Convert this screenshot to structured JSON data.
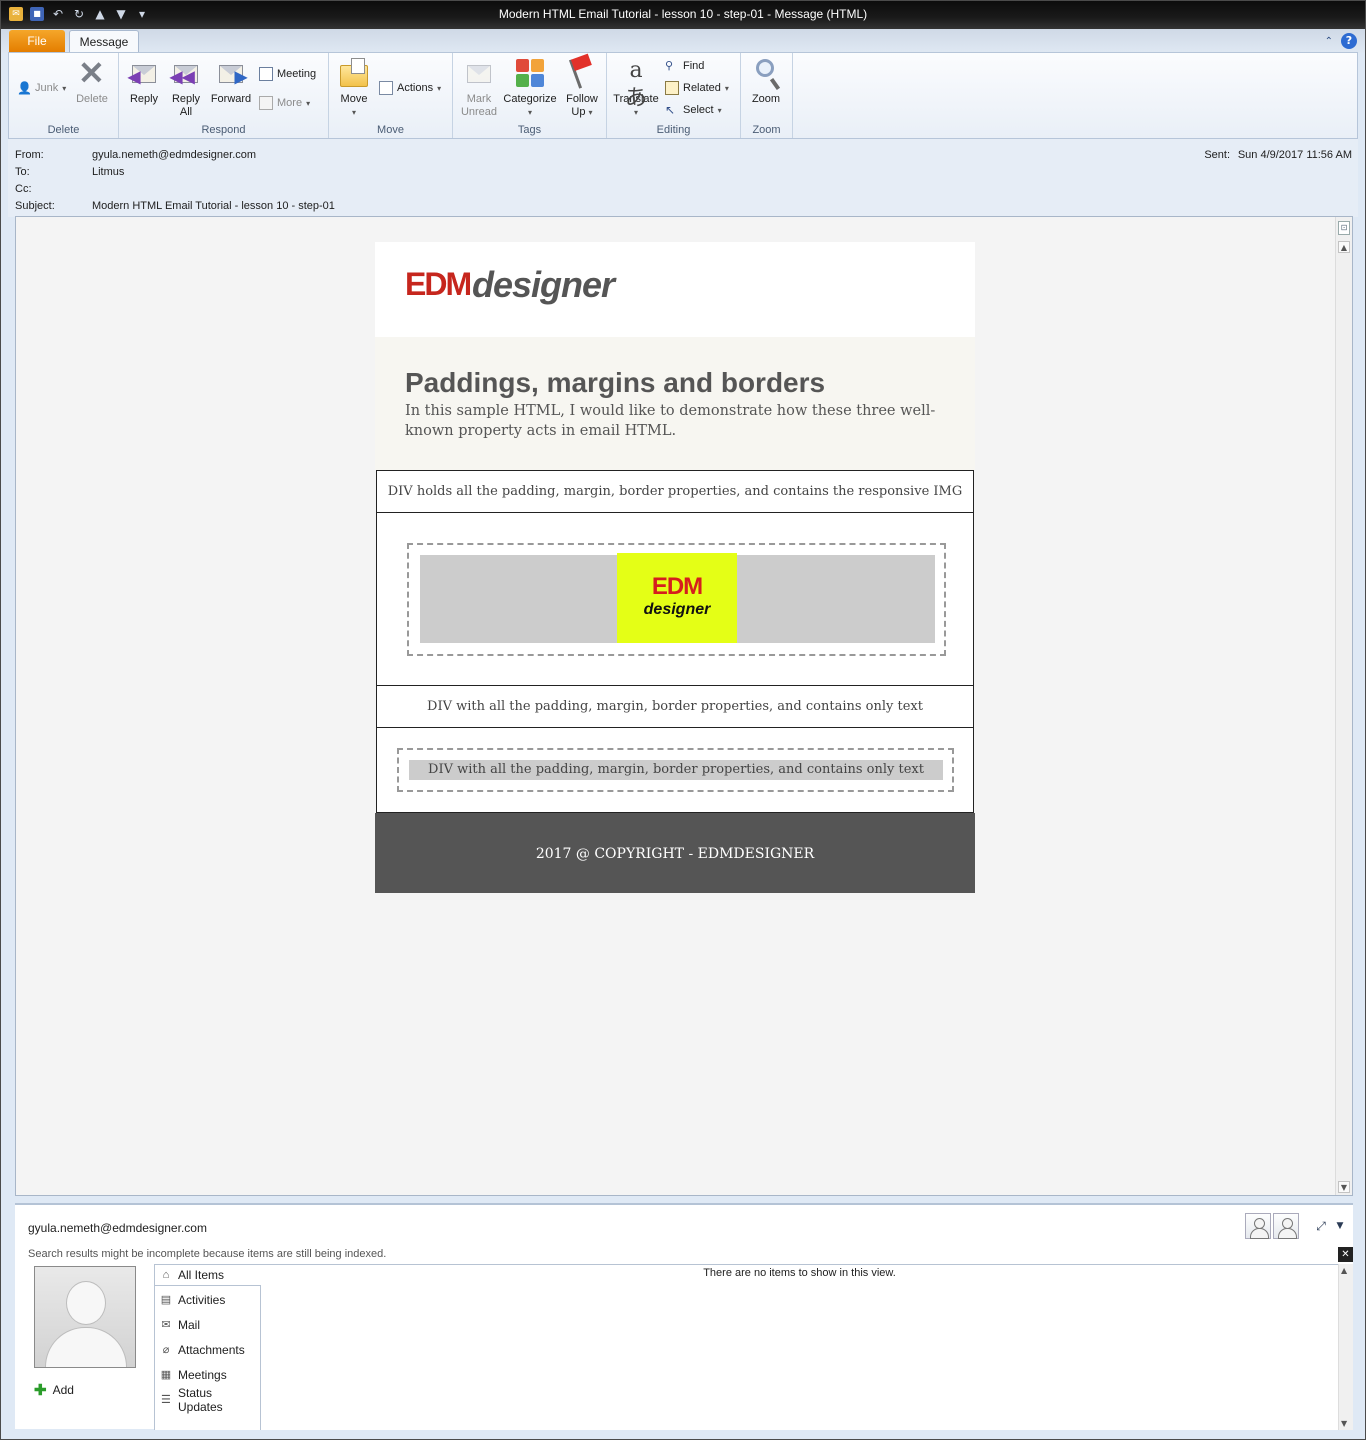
{
  "window": {
    "title": "Modern HTML Email Tutorial - lesson 10 - step-01  -  Message (HTML)"
  },
  "tabs": {
    "file": "File",
    "message": "Message"
  },
  "icons": {
    "qat": [
      "outlook-icon",
      "save-icon",
      "undo-icon",
      "redo-icon",
      "previous-item-icon",
      "next-item-icon",
      "customize-qat-icon"
    ],
    "ribbon_collapse": "chevron-up-icon",
    "help": "help-icon"
  },
  "ribbon": {
    "delete_group": {
      "label": "Delete",
      "junk": "Junk",
      "delete": "Delete"
    },
    "respond_group": {
      "label": "Respond",
      "reply": "Reply",
      "reply_all_1": "Reply",
      "reply_all_2": "All",
      "forward": "Forward",
      "meeting": "Meeting",
      "more": "More"
    },
    "move_group": {
      "label": "Move",
      "move": "Move",
      "actions": "Actions"
    },
    "tags_group": {
      "label": "Tags",
      "mark_unread_1": "Mark",
      "mark_unread_2": "Unread",
      "categorize": "Categorize",
      "follow_up_1": "Follow",
      "follow_up_2": "Up"
    },
    "editing_group": {
      "label": "Editing",
      "translate": "Translate",
      "find": "Find",
      "related": "Related",
      "select": "Select"
    },
    "zoom_group": {
      "label": "Zoom",
      "zoom": "Zoom"
    }
  },
  "header": {
    "from_label": "From:",
    "from_value": "gyula.nemeth@edmdesigner.com",
    "to_label": "To:",
    "to_value": "Litmus",
    "cc_label": "Cc:",
    "cc_value": "",
    "subject_label": "Subject:",
    "subject_value": "Modern HTML Email Tutorial - lesson 10 - step-01",
    "sent_label": "Sent:",
    "sent_value": "Sun 4/9/2017 11:56 AM"
  },
  "email": {
    "logo_edm": "EDM",
    "logo_designer": "designer",
    "title": "Paddings, margins and borders",
    "intro": "In this sample HTML, I would like to demonstrate how these three well-known property acts in email HTML.",
    "img_caption": "DIV holds all the padding, margin, border properties, and contains the responsive IMG",
    "img_logo_edm": "EDM",
    "img_logo_designer": "designer",
    "text_caption": "DIV with all the padding, margin, border properties, and contains only text",
    "text_box": "DIV with all the padding, margin, border properties, and contains only text",
    "footer": "2017 @ COPYRIGHT - EDMDESIGNER",
    "colors": {
      "brand_red": "#c6261d",
      "yellow": "#e4ff16",
      "footer_bg": "#555555",
      "hero_bg": "#f7f6f1"
    }
  },
  "people_pane": {
    "email": "gyula.nemeth@edmdesigner.com",
    "notice": "Search results might be incomplete because items are still being indexed.",
    "add": "Add",
    "nav": [
      {
        "label": "All Items",
        "icon": "home-icon"
      },
      {
        "label": "Activities",
        "icon": "activities-icon"
      },
      {
        "label": "Mail",
        "icon": "mail-icon"
      },
      {
        "label": "Attachments",
        "icon": "paperclip-icon"
      },
      {
        "label": "Meetings",
        "icon": "calendar-icon"
      },
      {
        "label": "Status Updates",
        "icon": "status-icon"
      }
    ],
    "empty": "There are no items to show in this view."
  }
}
